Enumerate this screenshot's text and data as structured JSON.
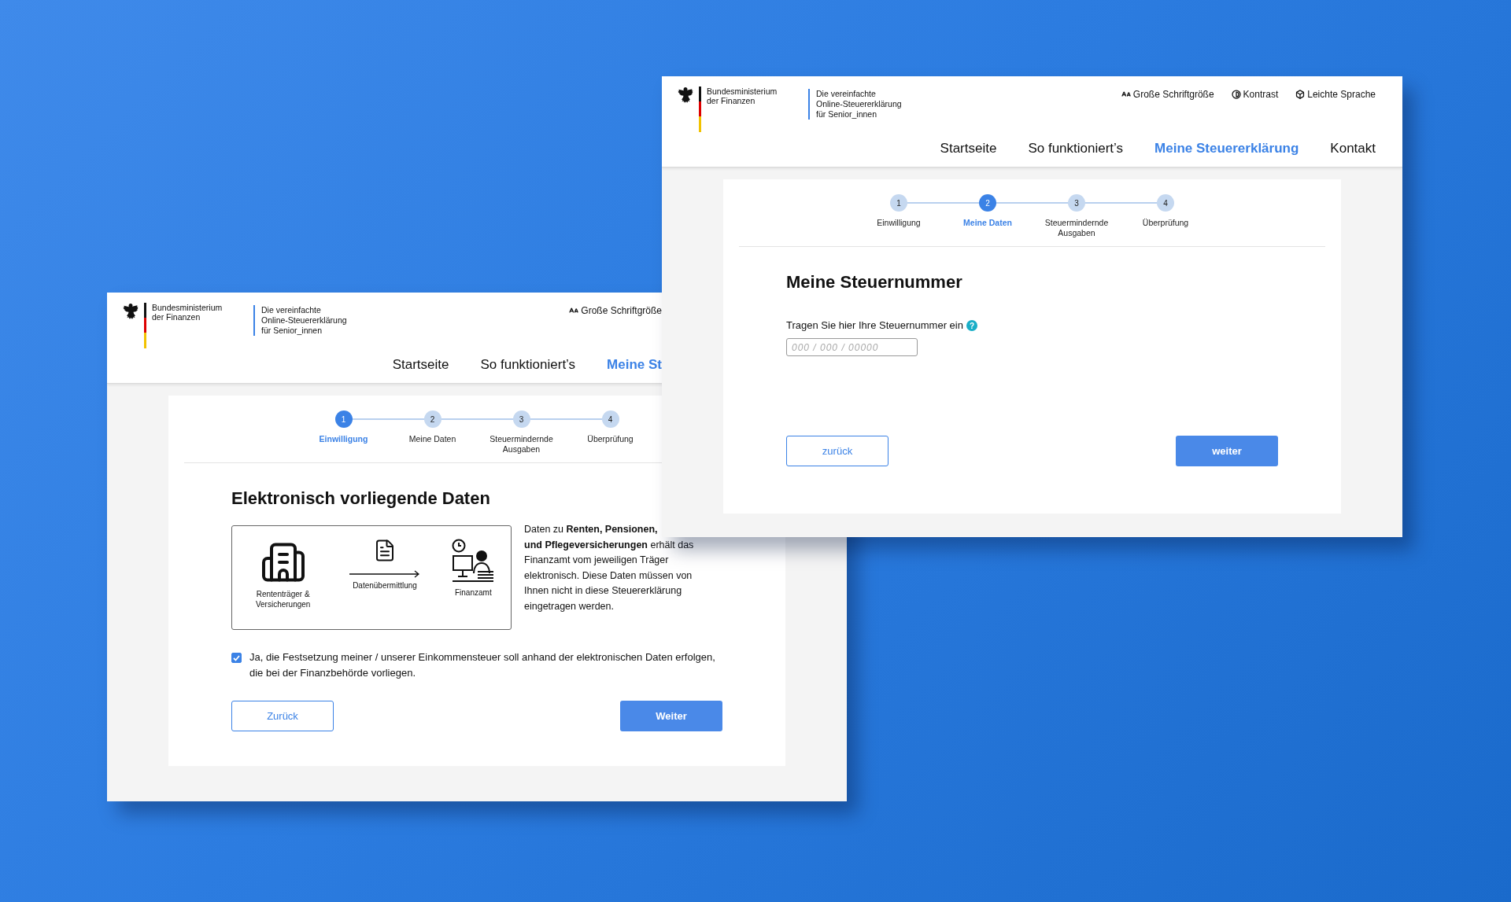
{
  "windows": [
    {
      "ministry": [
        "Bundesministerium",
        "der Finanzen"
      ],
      "service": [
        "Die vereinfachte",
        "Online-Steuererklärung",
        "für Senior_innen"
      ],
      "tools": [
        {
          "kind": "font-size",
          "label": "Große Schriftgröße"
        }
      ],
      "nav": [
        {
          "label": "Startseite",
          "selected": false
        },
        {
          "label": "So funktioniert’s",
          "selected": false
        },
        {
          "label": "Meine St",
          "selected": true
        }
      ],
      "steps": [
        {
          "number": "1",
          "label": "Einwilligung",
          "selected": true
        },
        {
          "number": "2",
          "label": "Meine Daten",
          "selected": false
        },
        {
          "number": "3",
          "label": "Steuermindernde Ausgaben",
          "selected": false
        },
        {
          "number": "4",
          "label": "Überprüfung",
          "selected": false
        }
      ],
      "content": {
        "kind": "consent",
        "title": "Elektronisch vorliegende Daten",
        "diagram": {
          "source": "Rententräger & Versicherungen",
          "transfer": "Datenübermittlung",
          "target": "Finanzamt"
        },
        "info": [
          "Daten zu **Renten, Pensionen,**",
          "**und Pflegeversicherungen** erhält das Finanzamt vom jeweiligen Träger elektronisch. Diese Daten müssen von Ihnen nicht in diese Steuererklärung eingetragen werden."
        ],
        "consent": {
          "checked": true,
          "label": "Ja, die Festsetzung meiner / unserer Einkommensteuer soll anhand der elektronischen Daten erfolgen, die bei der Finanzbehörde vorliegen."
        },
        "buttons": {
          "back": "Zurück",
          "next": "Weiter"
        }
      }
    },
    {
      "ministry": [
        "Bundesministerium",
        "der Finanzen"
      ],
      "service": [
        "Die vereinfachte",
        "Online-Steuererklärung",
        "für Senior_innen"
      ],
      "tools": [
        {
          "kind": "font-size",
          "label": "Große Schriftgröße"
        },
        {
          "kind": "contrast",
          "label": "Kontrast"
        },
        {
          "kind": "plain-language",
          "label": "Leichte Sprache"
        }
      ],
      "nav": [
        {
          "label": "Startseite",
          "selected": false
        },
        {
          "label": "So funktioniert’s",
          "selected": false
        },
        {
          "label": "Meine Steuererklärung",
          "selected": true
        },
        {
          "label": "Kontakt",
          "selected": false
        }
      ],
      "steps": [
        {
          "number": "1",
          "label": "Einwilligung",
          "selected": false
        },
        {
          "number": "2",
          "label": "Meine Daten",
          "selected": true
        },
        {
          "number": "3",
          "label": "Steuermindernde Ausgaben",
          "selected": false
        },
        {
          "number": "4",
          "label": "Überprüfung",
          "selected": false
        }
      ],
      "content": {
        "kind": "tax-number",
        "title": "Meine Steuernummer",
        "field_label": "Tragen Sie hier Ihre Steuernummer ein",
        "help": "?",
        "placeholder": "000 / 000 / 00000",
        "buttons": {
          "back": "zurück",
          "next": "weiter"
        }
      }
    }
  ]
}
